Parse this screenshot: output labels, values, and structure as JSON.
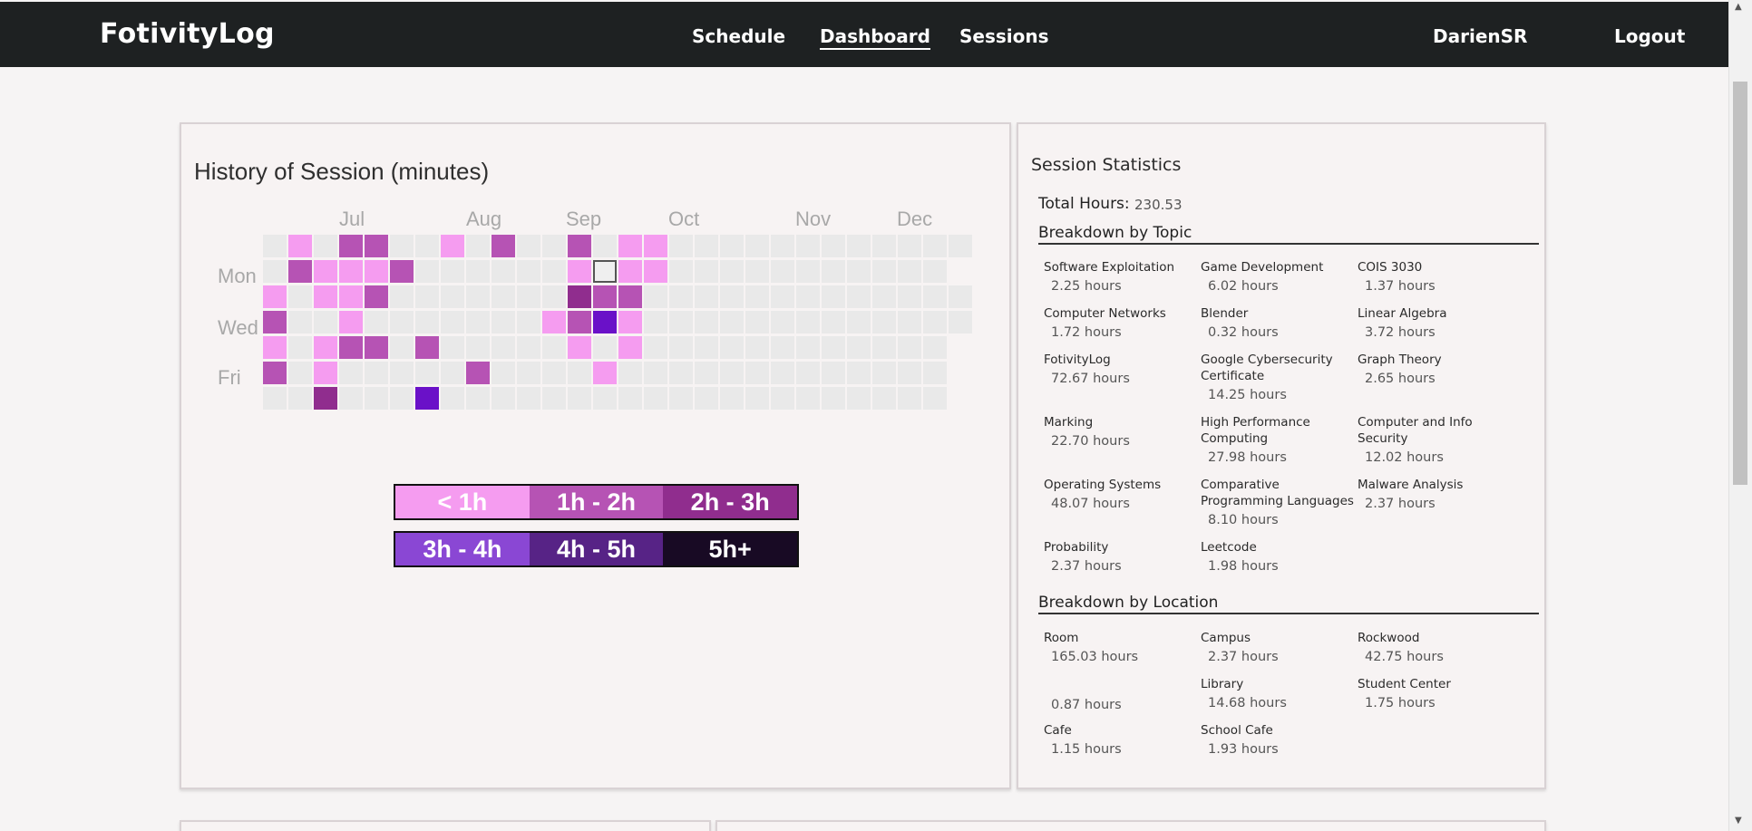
{
  "nav": {
    "brand": "FotivityLog",
    "links": [
      "Schedule",
      "Dashboard",
      "Sessions"
    ],
    "user": "DarienSR",
    "logout": "Logout"
  },
  "history": {
    "title": "History of Session (minutes)",
    "months": [
      "Jul",
      "Aug",
      "Sep",
      "Oct",
      "Nov",
      "Dec"
    ],
    "day_labels": [
      "Mon",
      "Wed",
      "Fri"
    ],
    "legend": [
      {
        "label": "< 1h",
        "color": "#f59cf0"
      },
      {
        "label": "1h - 2h",
        "color": "#b653b4"
      },
      {
        "label": "2h - 3h",
        "color": "#902d8e"
      },
      {
        "label": "3h - 4h",
        "color": "#8a47d4"
      },
      {
        "label": "4h - 5h",
        "color": "#572386"
      },
      {
        "label": "5h+",
        "color": "#180a24"
      }
    ],
    "empty_color": "#e9e9e9",
    "level_colors": [
      "#e9e9e9",
      "#f59cf0",
      "#b653b4",
      "#902d8e",
      "#6a11c8"
    ],
    "heatmap_rows": [
      "0102200102002011000000000000",
      "0211120000001S1100000000000",
      "1011200000003220000000000000",
      "2001000000012410000000000000",
      "1012202000001010000000000000",
      "2010000020000100000000000000",
      "0030004000000000000000000000"
    ]
  },
  "stats": {
    "title": "Session Statistics",
    "total_label": "Total Hours:",
    "total_value": "230.53",
    "topic_heading": "Breakdown by Topic",
    "topics": [
      {
        "name": "Software Exploitation",
        "hours": "2.25 hours"
      },
      {
        "name": "Game Development",
        "hours": "6.02 hours"
      },
      {
        "name": "COIS 3030",
        "hours": "1.37 hours"
      },
      {
        "name": "Computer Networks",
        "hours": "1.72 hours"
      },
      {
        "name": "Blender",
        "hours": "0.32 hours"
      },
      {
        "name": "Linear Algebra",
        "hours": "3.72 hours"
      },
      {
        "name": "FotivityLog",
        "hours": "72.67 hours"
      },
      {
        "name": "Google Cybersecurity Certificate",
        "hours": "14.25 hours"
      },
      {
        "name": "Graph Theory",
        "hours": "2.65 hours"
      },
      {
        "name": "Marking",
        "hours": "22.70 hours"
      },
      {
        "name": "High Performance Computing",
        "hours": "27.98 hours"
      },
      {
        "name": "Computer and Info Security",
        "hours": "12.02 hours"
      },
      {
        "name": "Operating Systems",
        "hours": "48.07 hours"
      },
      {
        "name": "Comparative Programming Languages",
        "hours": "8.10 hours"
      },
      {
        "name": "Malware Analysis",
        "hours": "2.37 hours"
      },
      {
        "name": "Probability",
        "hours": "2.37 hours"
      },
      {
        "name": "Leetcode",
        "hours": "1.98 hours"
      }
    ],
    "location_heading": "Breakdown by Location",
    "locations": [
      {
        "name": "Room",
        "hours": "165.03 hours"
      },
      {
        "name": "Campus",
        "hours": "2.37 hours"
      },
      {
        "name": "Rockwood",
        "hours": "42.75 hours"
      },
      {
        "name": "",
        "hours": "0.87 hours"
      },
      {
        "name": "Library",
        "hours": "14.68 hours"
      },
      {
        "name": "Student Center",
        "hours": "1.75 hours"
      },
      {
        "name": "Cafe",
        "hours": "1.15 hours"
      },
      {
        "name": "School Cafe",
        "hours": "1.93 hours"
      }
    ]
  }
}
